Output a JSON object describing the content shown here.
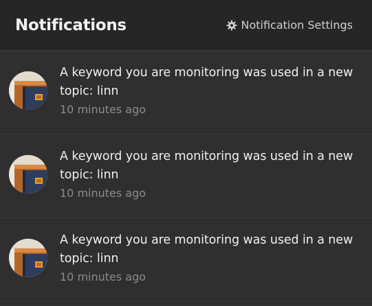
{
  "header": {
    "title": "Notifications",
    "settings_label": "Notification Settings",
    "settings_icon": "gear-icon"
  },
  "notifications": [
    {
      "message": "A keyword you are monitoring was used in a new topic: linn",
      "time": "10 minutes ago",
      "avatar": "user-avatar"
    },
    {
      "message": "A keyword you are monitoring was used in a new topic: linn",
      "time": "10 minutes ago",
      "avatar": "user-avatar"
    },
    {
      "message": "A keyword you are monitoring was used in a new topic: linn",
      "time": "10 minutes ago",
      "avatar": "user-avatar"
    }
  ],
  "colors": {
    "background": "#2f2f2f",
    "header_background": "#262626",
    "primary_text": "#f0f0f0",
    "secondary_text": "#8c8c8c",
    "accent": "#f0a020"
  }
}
